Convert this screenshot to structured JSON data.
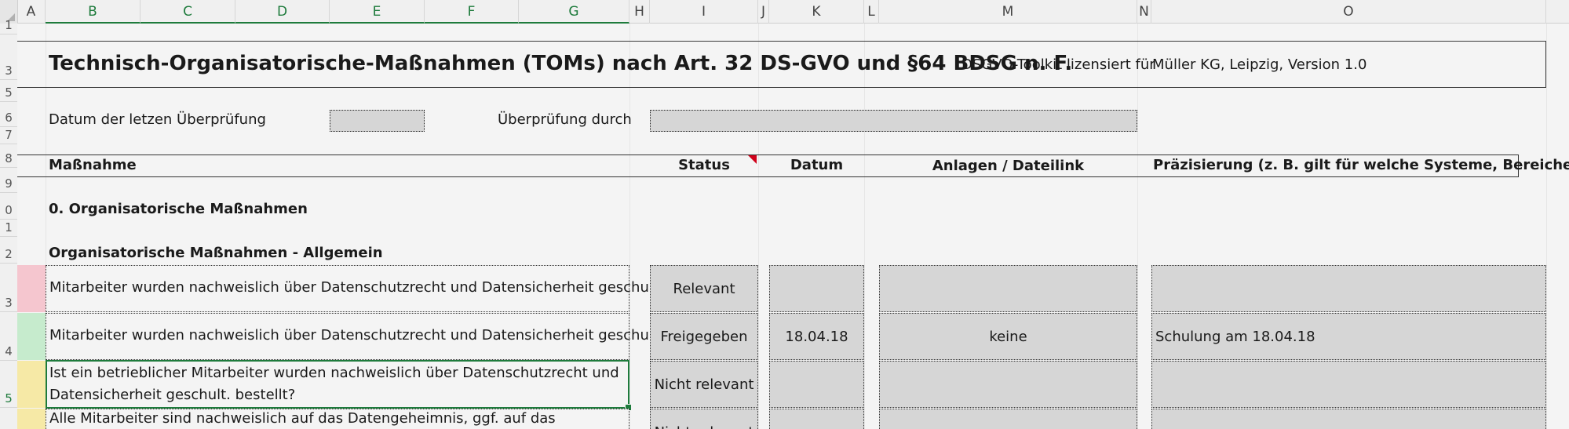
{
  "columns": [
    "A",
    "B",
    "C",
    "D",
    "E",
    "F",
    "G",
    "H",
    "I",
    "J",
    "K",
    "L",
    "M",
    "N",
    "O"
  ],
  "rows": [
    "1",
    "3",
    "5",
    "6",
    "7",
    "8",
    "9",
    "0",
    "1",
    "2",
    "3",
    "4",
    "5"
  ],
  "title": {
    "main": "Technisch-Organisatorische-Maßnahmen (TOMs) nach Art. 32 DS-GVO und §64 BDSG n. F.",
    "license_label": "DSGVO-Toolkit lizensiert für",
    "licensee": "Müller KG, Leipzig, Version 1.0"
  },
  "review": {
    "date_label": "Datum der letzen Überprüfung",
    "date_value": "",
    "by_label": "Überprüfung durch",
    "by_value": ""
  },
  "table_headers": {
    "measure": "Maßnahme",
    "status": "Status",
    "date": "Datum",
    "attachments": "Anlagen / Dateilink",
    "precision": "Präzisierung (z. B. gilt für welche Systeme, Bereiche)"
  },
  "sections": {
    "s0": "0. Organisatorische Maßnahmen",
    "s1": "Organisatorische Maßnahmen - Allgemein"
  },
  "measures": [
    {
      "text": "Mitarbeiter wurden nachweislich über Datenschutzrecht und Datensicherheit geschult.",
      "status": "Relevant",
      "date": "",
      "attachment": "",
      "precision": "",
      "color": "#f5c6cf"
    },
    {
      "text": "Mitarbeiter wurden nachweislich über Datenschutzrecht und Datensicherheit geschult.",
      "status": "Freigegeben",
      "date": "18.04.18",
      "attachment": "keine",
      "precision": "Schulung am 18.04.18",
      "color": "#c6ebcd"
    },
    {
      "text_line1": "Ist ein betrieblicher Mitarbeiter wurden nachweislich über Datenschutzrecht und",
      "text_line2": "Datensicherheit geschult. bestellt?",
      "status": "Nicht relevant",
      "date": "",
      "attachment": "",
      "precision": "",
      "color": "#f6e9a6"
    },
    {
      "text": "Alle Mitarbeiter sind nachweislich auf das Datengeheimnis, ggf. auf das",
      "status": "Nicht relevant",
      "date": "",
      "attachment": "",
      "precision": "",
      "color": "#f6e9a6"
    }
  ]
}
